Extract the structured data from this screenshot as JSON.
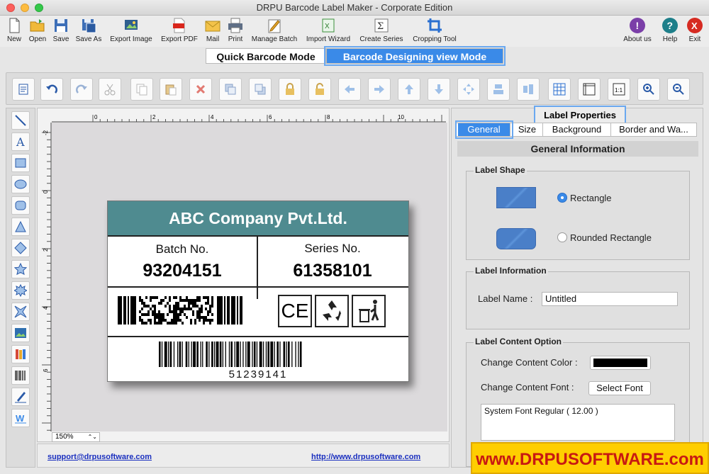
{
  "window": {
    "title": "DRPU Barcode Label Maker - Corporate Edition"
  },
  "toolbar": {
    "new": "New",
    "open": "Open",
    "save": "Save",
    "save_as": "Save As",
    "export_image": "Export Image",
    "export_pdf": "Export PDF",
    "mail": "Mail",
    "print": "Print",
    "manage_batch": "Manage Batch",
    "import_wizard": "Import Wizard",
    "create_series": "Create Series",
    "cropping_tool": "Cropping Tool",
    "about_us": "About us",
    "help": "Help",
    "exit": "Exit"
  },
  "modes": {
    "quick": "Quick Barcode Mode",
    "design": "Barcode Designing view Mode"
  },
  "canvas": {
    "zoom": "150%",
    "ruler_top": [
      "0",
      "2",
      "4",
      "6",
      "8",
      "10"
    ],
    "ruler_left": [
      "-2",
      "0",
      "2",
      "4",
      "6"
    ]
  },
  "label": {
    "company": "ABC Company Pvt.Ltd.",
    "batch_caption": "Batch No.",
    "batch_value": "93204151",
    "series_caption": "Series No.",
    "series_value": "61358101",
    "barcode_number": "51239141",
    "ce_mark": "CE",
    "header_color": "#4f8b90"
  },
  "footer": {
    "support": "support@drpusoftware.com",
    "website": "http://www.drpusoftware.com"
  },
  "properties": {
    "title": "Label Properties",
    "tabs": {
      "general": "General",
      "size": "Size",
      "background": "Background",
      "border": "Border and Wa..."
    },
    "section": "General Information",
    "label_shape": {
      "title": "Label Shape",
      "rectangle": "Rectangle",
      "rounded": "Rounded Rectangle",
      "selected": "Rectangle"
    },
    "label_info": {
      "title": "Label Information",
      "name_label": "Label Name :",
      "name_value": "Untitled"
    },
    "content": {
      "title": "Label Content Option",
      "color_label": "Change Content Color :",
      "color_value": "#000000",
      "font_label": "Change Content Font :",
      "font_button": "Select Font",
      "font_value": "System Font Regular ( 12.00 )"
    }
  },
  "brand": "www.DRPUSOFTWARE.com"
}
